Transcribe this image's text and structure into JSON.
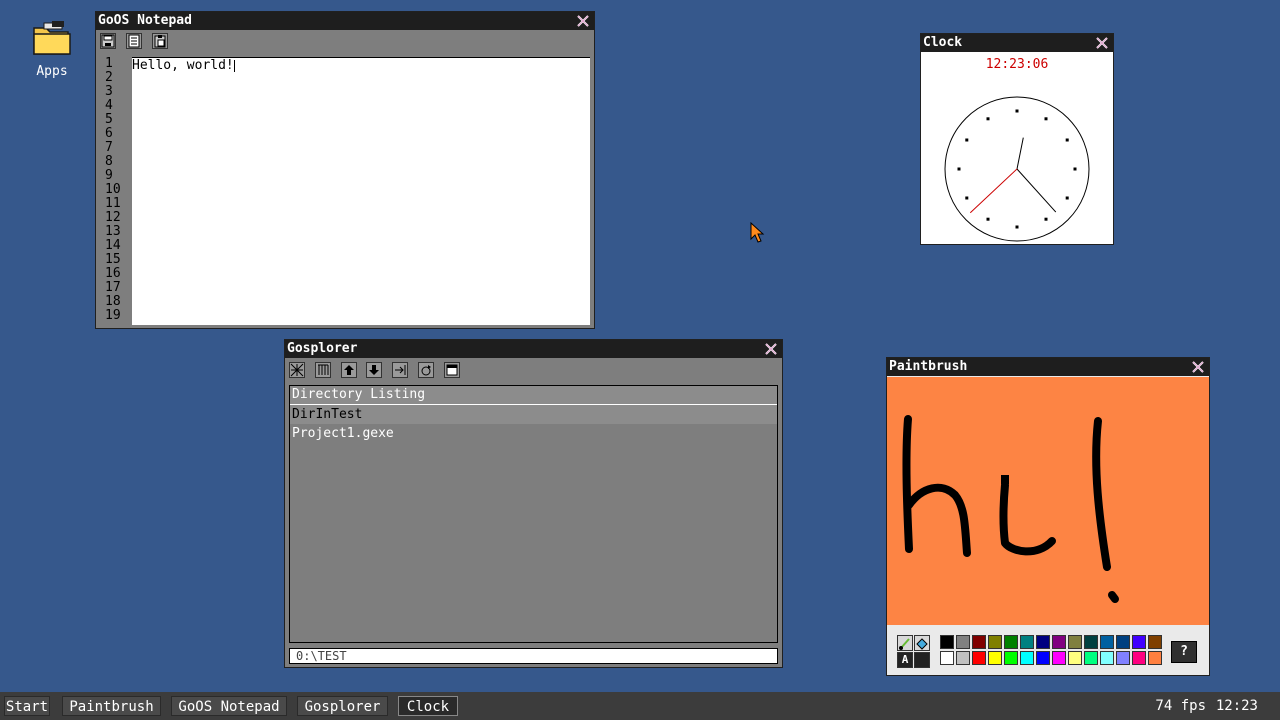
{
  "desktop": {
    "icons": [
      {
        "label": "Apps",
        "icon": "folder-icon"
      }
    ]
  },
  "windows": {
    "notepad": {
      "title": "GoOS Notepad",
      "toolbar": [
        "save-icon",
        "open-icon",
        "paste-icon"
      ],
      "line_numbers": [
        "1",
        "2",
        "3",
        "4",
        "5",
        "6",
        "7",
        "8",
        "9",
        "10",
        "11",
        "12",
        "13",
        "14",
        "15",
        "16",
        "17",
        "18",
        "19"
      ],
      "text": "Hello, world!"
    },
    "clock": {
      "title": "Clock",
      "time": "12:23:06",
      "hands": {
        "hour": 12.38,
        "minute": 23,
        "second": 6
      },
      "colors": {
        "time": "#cc0000",
        "second_hand": "#cc0000"
      }
    },
    "gosplorer": {
      "title": "Gosplorer",
      "toolbar": [
        "grid-icon",
        "list-icon",
        "up-icon",
        "down-icon",
        "enter-icon",
        "refresh-icon",
        "window-icon"
      ],
      "header": "Directory Listing",
      "items": [
        {
          "name": "DirInTest"
        },
        {
          "name": "Project1.gexe"
        }
      ],
      "path": "0:\\TEST"
    },
    "paintbrush": {
      "title": "Paintbrush",
      "canvas_color": "#fd8444",
      "palette_top": [
        "#000000",
        "#808080",
        "#800000",
        "#808000",
        "#008000",
        "#008080",
        "#000080",
        "#800080",
        "#808040",
        "#004040",
        "#0060a0",
        "#004080",
        "#4000ff",
        "#804000"
      ],
      "palette_bottom": [
        "#ffffff",
        "#c0c0c0",
        "#ff0000",
        "#ffff00",
        "#00ff00",
        "#00ffff",
        "#0000ff",
        "#ff00ff",
        "#ffff80",
        "#00ff80",
        "#80ffff",
        "#8080ff",
        "#ff0080",
        "#ff8040"
      ],
      "help_label": "?",
      "text_tool_label": "A"
    }
  },
  "taskbar": {
    "start": "Start",
    "buttons": [
      "Paintbrush",
      "GoOS Notepad",
      "Gosplorer",
      "Clock"
    ],
    "fps": "74 fps",
    "clock": "12:23"
  }
}
